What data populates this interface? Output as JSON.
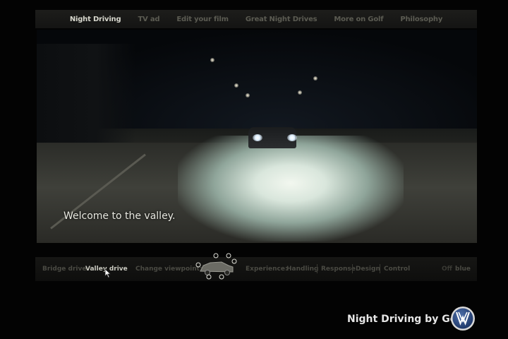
{
  "nav": {
    "items": [
      {
        "label": "Night Driving",
        "active": true
      },
      {
        "label": "TV ad"
      },
      {
        "label": "Edit your film"
      },
      {
        "label": "Great Night Drives"
      },
      {
        "label": "More on Golf"
      },
      {
        "label": "Philosophy"
      }
    ]
  },
  "video": {
    "caption": "Welcome to the valley."
  },
  "controls": {
    "drives": [
      {
        "label": "Bridge drive",
        "selected": false
      },
      {
        "label": "Valley drive",
        "selected": true
      }
    ],
    "viewpoint_label": "Change viewpoint:",
    "experience_label": "Experience:",
    "experience_options": [
      "Handling",
      "Response",
      "Design",
      "Control"
    ],
    "toggle_off": "Off",
    "toggle_blue": "blue"
  },
  "footer": {
    "title": "Night Driving by Golf",
    "logo": "VW"
  },
  "colors": {
    "nav_active": "#d6d6cc",
    "nav_inactive": "#5b5b52",
    "background": "#030303"
  }
}
